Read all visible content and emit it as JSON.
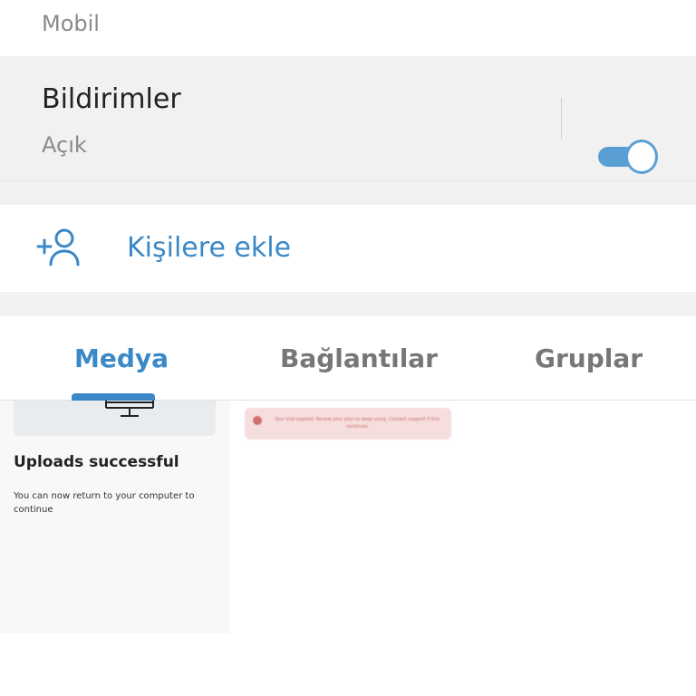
{
  "top_row": {
    "subtitle": "Mobil"
  },
  "notifications": {
    "title": "Bildirimler",
    "status": "Açık",
    "toggle_on": true
  },
  "add_contact": {
    "icon": "add-person-icon",
    "label": "Kişilere ekle"
  },
  "tabs": [
    {
      "label": "Medya",
      "active": true
    },
    {
      "label": "Bağlantılar",
      "active": false
    },
    {
      "label": "Gruplar",
      "active": false
    }
  ],
  "media": [
    {
      "title": "Uploads successful",
      "description": "You can now return to your computer to continue"
    },
    {
      "text": "Your trial expired. Renew your plan to keep using. Contact support if this continues"
    }
  ],
  "colors": {
    "accent": "#3a88c7",
    "toggle": "#5a9fd4",
    "section_bg": "#f1f1f1"
  }
}
